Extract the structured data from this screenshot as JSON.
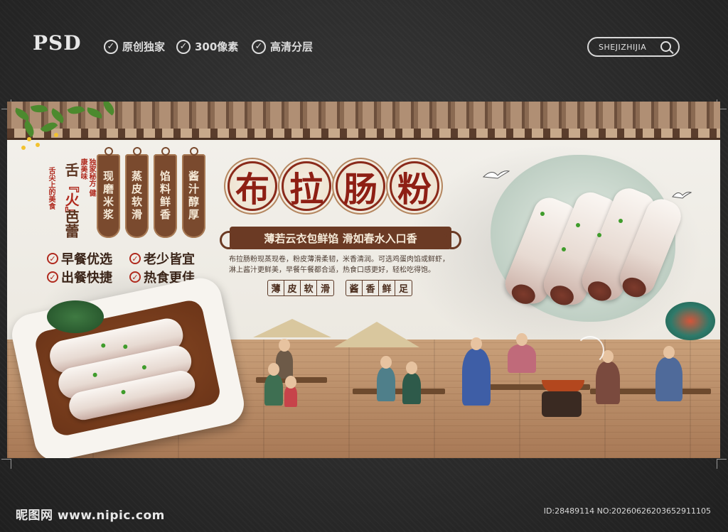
{
  "header": {
    "logo": "PSD",
    "features": [
      "原创独家",
      "300像素",
      "高清分层"
    ],
    "search_label": "SHEJIZHIJIA"
  },
  "banner": {
    "side_text": {
      "big_top": "舌",
      "big_fire": "『火』",
      "big_bottom": "芭蕾",
      "small_left": "舌尖上的美食",
      "small_right": "独家秘方 健康美味"
    },
    "tags": [
      "现磨米浆",
      "蒸皮软滑",
      "馅料鲜香",
      "酱汁醇厚"
    ],
    "bullets": [
      "早餐优选",
      "老少皆宜",
      "出餐快捷",
      "热食更佳"
    ],
    "title_chars": [
      "布",
      "拉",
      "肠",
      "粉"
    ],
    "slogan": "薄若云衣包鲜馅 滑如春水入口香",
    "description": "布拉肠粉现蒸现卷，粉皮薄滑柔韧，米香清润。可选鸡蛋肉馅或鲜虾，淋上酱汁更鲜美，早餐午餐都合适，热食口感更好，轻松吃得饱。",
    "chips_left": [
      "薄",
      "皮",
      "软",
      "滑"
    ],
    "chips_right": [
      "酱",
      "香",
      "鲜",
      "足"
    ]
  },
  "footer": {
    "site": "昵图网 www.nipic.com",
    "id_text": "ID:28489114 NO:20260626203652911105"
  },
  "colors": {
    "brand_red": "#8e1f14",
    "ribbon_brown": "#6b3a24",
    "page_bg": "#2b2b2b"
  }
}
